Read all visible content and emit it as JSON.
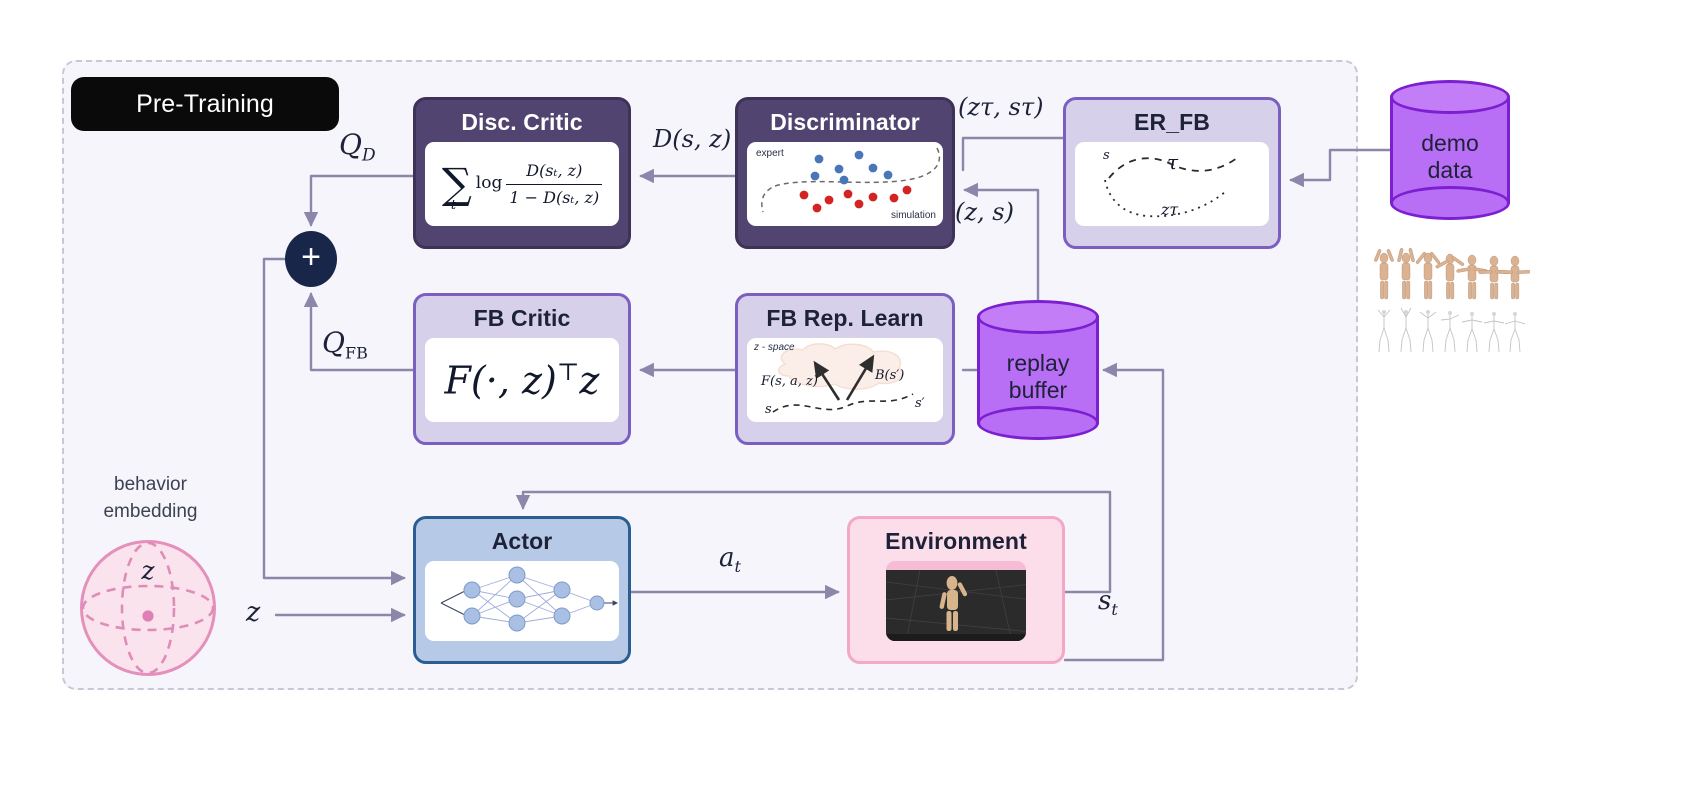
{
  "panel": {
    "title": "Pre-Training"
  },
  "nodes": {
    "disc_critic": {
      "title": "Disc. Critic",
      "formula": {
        "sigma": "∑",
        "sigma_sub": "t",
        "log": "log",
        "numerator": "D(sₜ, z)",
        "denominator": "1 − D(sₜ, z)"
      }
    },
    "discriminator": {
      "title": "Discriminator",
      "caption_top": "expert",
      "caption_bottom": "simulation"
    },
    "er_fb": {
      "title": "ER_FB",
      "label_s": "s",
      "label_tau": "τ",
      "label_ztau": "zτ"
    },
    "fb_critic": {
      "title": "FB Critic",
      "formula_main": "F(·, z)",
      "formula_sup": "⊤",
      "formula_tail": "z"
    },
    "fb_rep_learn": {
      "title": "FB Rep. Learn",
      "label_zspace": "z - space",
      "label_F": "F(s, a, z)",
      "label_B": "B(s′)",
      "label_s": "s",
      "label_sprime": "s′"
    },
    "actor": {
      "title": "Actor"
    },
    "environment": {
      "title": "Environment"
    },
    "replay_buffer": {
      "title_line1": "replay",
      "title_line2": "buffer"
    },
    "demo_data": {
      "title_line1": "demo",
      "title_line2": "data"
    }
  },
  "behavior_embedding": {
    "caption_line1": "behavior",
    "caption_line2": "embedding",
    "sphere_symbol": "z"
  },
  "edge_labels": {
    "q_d": "Q",
    "q_d_sub": "D",
    "q_fb": "Q",
    "q_fb_sub": "FB",
    "d_s_z": "D(s, z)",
    "z_tau_s_tau": "(zτ, sτ)",
    "z_s": "(z, s)",
    "a_t": "a",
    "a_t_sub": "t",
    "s_t": "s",
    "s_t_sub": "t",
    "z_input": "z"
  },
  "colors": {
    "panel_bg": "#f6f5fb",
    "panel_border": "#c9c7d6",
    "title_pill": "#0a0a0a",
    "dark_purple_card": "#514470",
    "light_lavender_card": "#d6d0ea",
    "purple_border": "#7a5fc0",
    "actor_blue": "#b6c9e6",
    "actor_border": "#2b5d92",
    "env_pink": "#fcdeea",
    "env_border": "#f5a7c6",
    "cylinder_fill": "#b86ef5",
    "cylinder_border": "#7b1fd0",
    "sum_node": "#18264a",
    "wire": "#8d86ab",
    "sphere_fill": "#fbe3ee",
    "sphere_border": "#e490bb",
    "text_dark": "#1d2238"
  }
}
